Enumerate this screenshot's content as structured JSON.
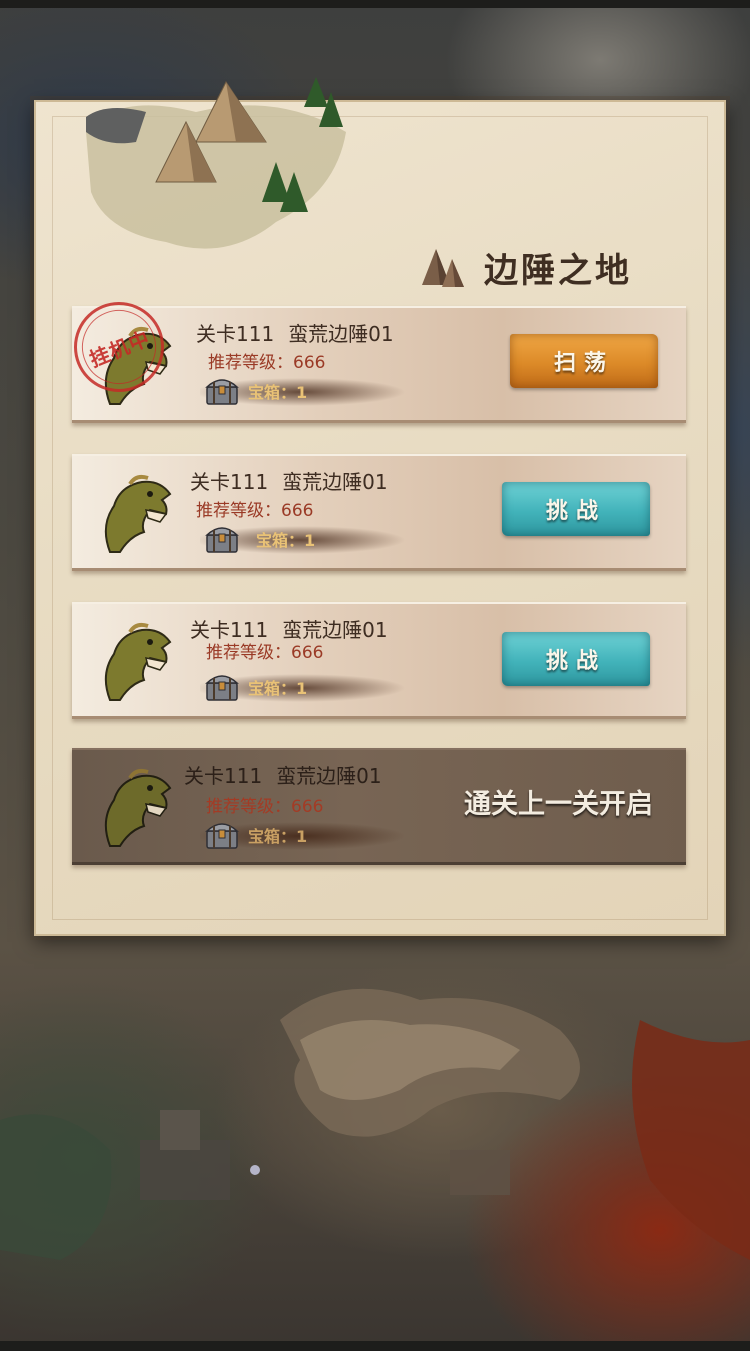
{
  "panel": {
    "title": "边陲之地",
    "title_icon": "mountain-icon"
  },
  "stages": [
    {
      "id_label": "关卡111",
      "name": "蛮荒边陲01",
      "level_label": "推荐等级：666",
      "chest_label": "宝箱：1",
      "status": "auto-battling",
      "stamp_label": "挂机中",
      "action_label": "扫荡"
    },
    {
      "id_label": "关卡111",
      "name": "蛮荒边陲01",
      "level_label": "推荐等级：666",
      "chest_label": "宝箱：1",
      "status": "available",
      "action_label": "挑战"
    },
    {
      "id_label": "关卡111",
      "name": "蛮荒边陲01",
      "level_label": "推荐等级：666",
      "chest_label": "宝箱：1",
      "status": "available",
      "action_label": "挑战"
    },
    {
      "id_label": "关卡111",
      "name": "蛮荒边陲01",
      "level_label": "推荐等级：666",
      "chest_label": "宝箱：1",
      "status": "locked",
      "locked_label": "通关上一关开启"
    }
  ],
  "colors": {
    "sweep_button": "#dc8a28",
    "challenge_button": "#42b3ba",
    "level_text": "#9a3a26",
    "chest_text": "#e9c276",
    "stamp": "#c42a26"
  }
}
